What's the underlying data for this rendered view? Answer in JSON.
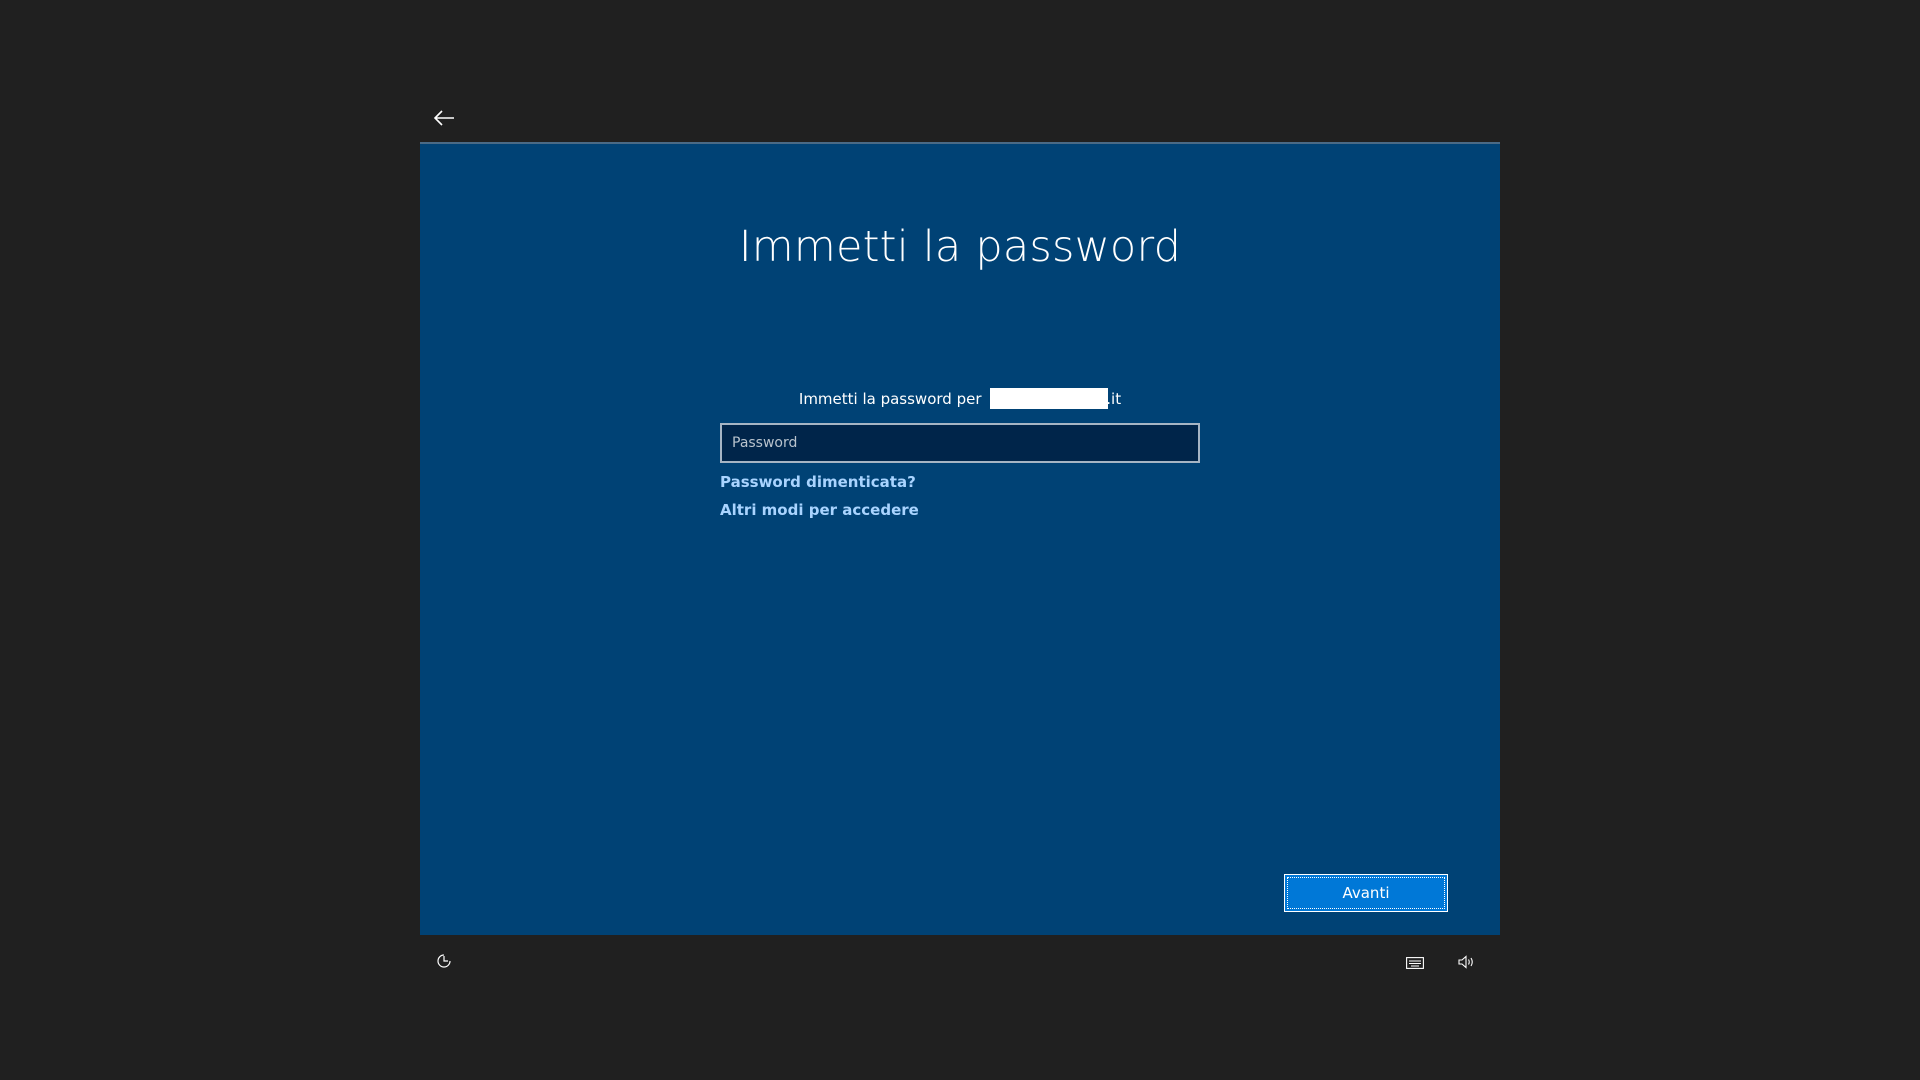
{
  "header": {
    "back_icon": "back-arrow-icon"
  },
  "main": {
    "title": "Immetti la password",
    "subtitle_prefix": "Immetti la password per",
    "subtitle_suffix": ".it",
    "password_placeholder": "Password",
    "password_value": "",
    "forgot_link": "Password dimenticata?",
    "other_ways_link": "Altri modi per accedere",
    "next_button": "Avanti"
  },
  "footer": {
    "icons": [
      "ease-of-access-icon",
      "keyboard-icon",
      "volume-icon"
    ]
  },
  "colors": {
    "background": "#202020",
    "panel": "#004275",
    "field": "#00254a",
    "link": "#a9d4ff",
    "button": "#0078d7"
  }
}
